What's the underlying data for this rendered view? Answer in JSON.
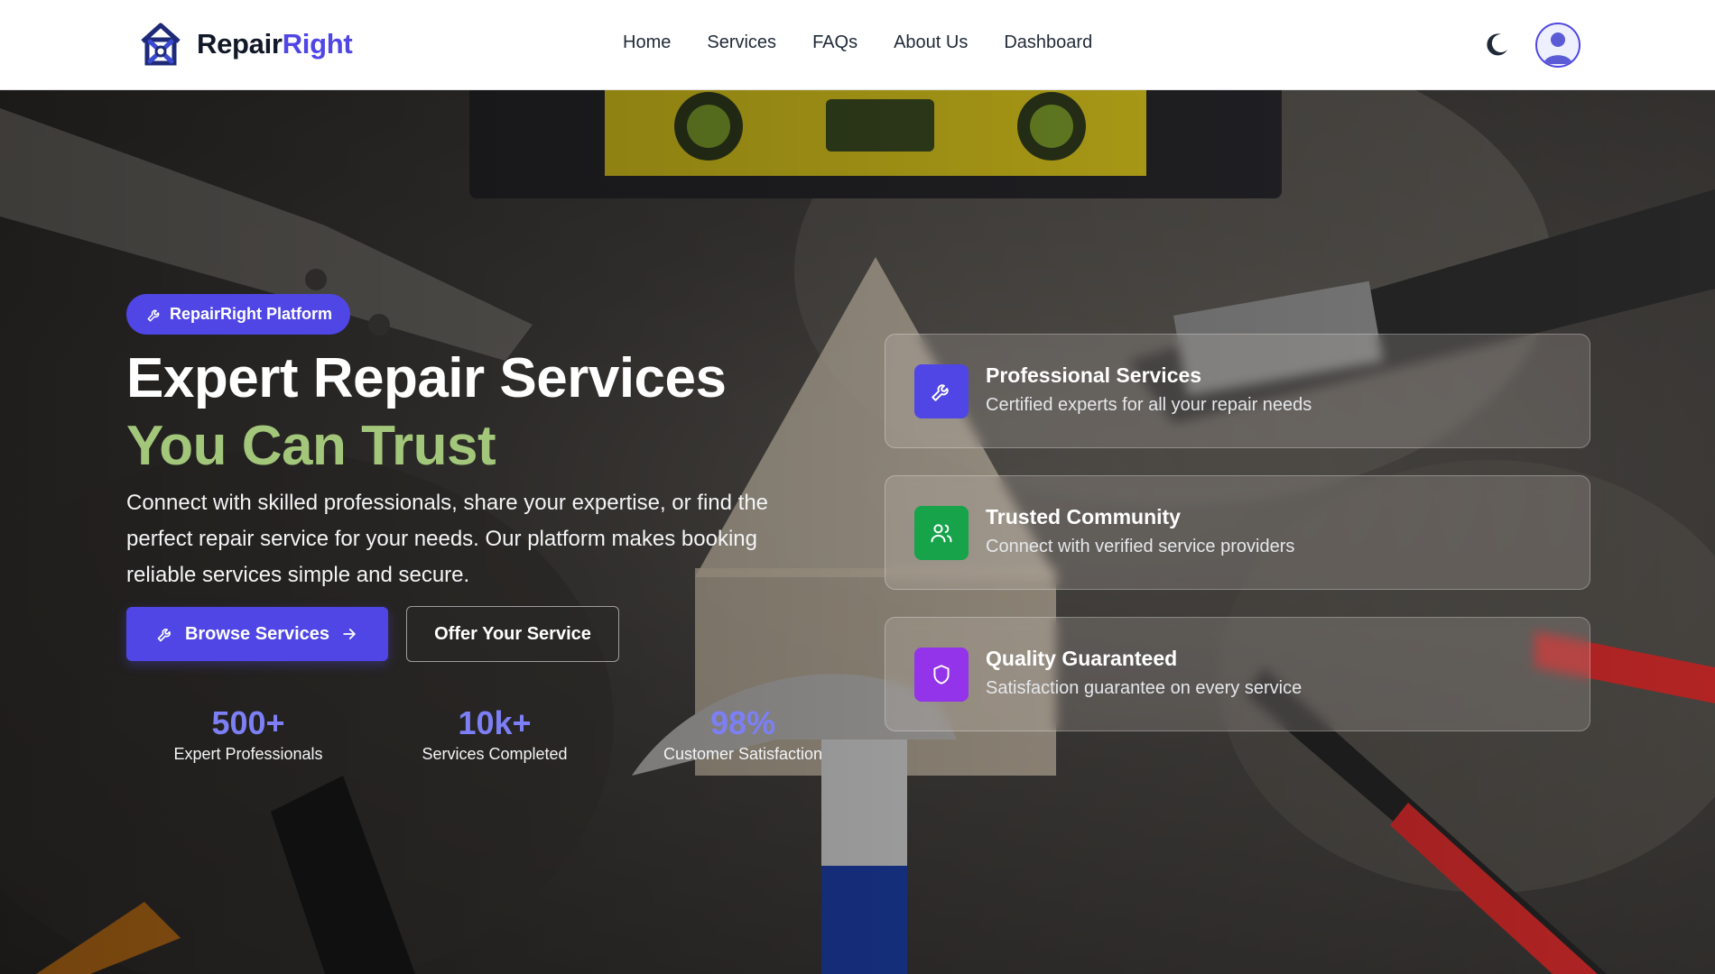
{
  "brand": {
    "name_part1": "Repair",
    "name_part2": "Right",
    "accent_color": "#4f46e5"
  },
  "nav": {
    "items": [
      "Home",
      "Services",
      "FAQs",
      "About Us",
      "Dashboard"
    ]
  },
  "header_icons": {
    "theme_toggle": "moon-icon",
    "profile": "user-avatar-icon"
  },
  "hero": {
    "badge": "RepairRight Platform",
    "headline_line1": "Expert Repair Services",
    "headline_line2": "You Can Trust",
    "description": "Connect with skilled professionals, share your expertise, or find the perfect repair service for your needs. Our platform makes booking reliable services simple and secure.",
    "primary_button": "Browse Services",
    "secondary_button": "Offer Your Service",
    "stats": [
      {
        "value": "500+",
        "label": "Expert Professionals"
      },
      {
        "value": "10k+",
        "label": "Services Completed"
      },
      {
        "value": "98%",
        "label": "Customer Satisfaction"
      }
    ]
  },
  "features": [
    {
      "title": "Professional Services",
      "subtitle": "Certified experts for all your repair needs",
      "icon": "wrench-icon",
      "color": "#4f46e5"
    },
    {
      "title": "Trusted Community",
      "subtitle": "Connect with verified service providers",
      "icon": "users-icon",
      "color": "#16a34a"
    },
    {
      "title": "Quality Guaranteed",
      "subtitle": "Satisfaction guarantee on every service",
      "icon": "shield-icon",
      "color": "#9333ea"
    }
  ],
  "colors": {
    "primary": "#4f46e5",
    "headline_accent": "#a3c77a",
    "stat_value": "#7c7ff5"
  }
}
